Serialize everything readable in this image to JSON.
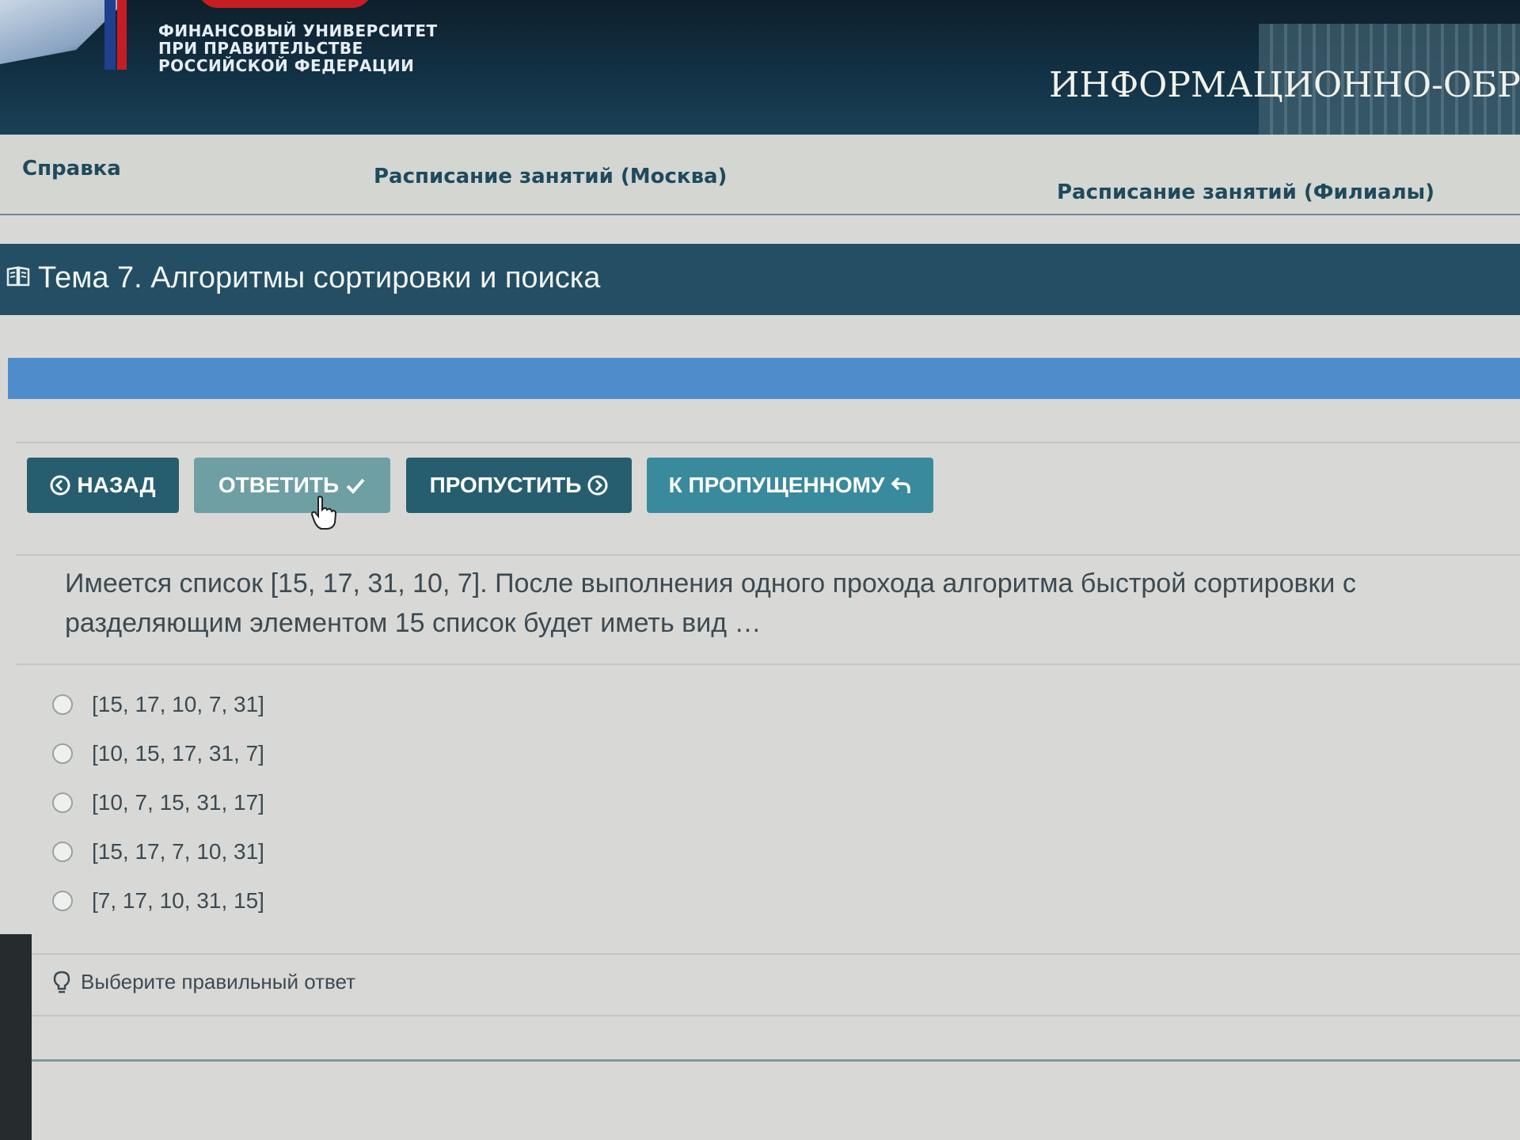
{
  "header": {
    "univ_line1": "ФИНАНСОВЫЙ УНИВЕРСИТЕТ",
    "univ_line2": "ПРИ ПРАВИТЕЛЬСТВЕ",
    "univ_line3": "РОССИЙСКОЙ ФЕДЕРАЦИИ",
    "portal_title": "ИНФОРМАЦИОННО-ОБРА"
  },
  "nav": {
    "help": "Справка",
    "schedule_moscow": "Расписание занятий (Москва)",
    "schedule_branches": "Расписание занятий (Филиалы)"
  },
  "topic": {
    "title": "Тема 7. Алгоритмы сортировки и поиска",
    "icon": "book-icon"
  },
  "progress": {
    "fraction": 1.0
  },
  "buttons": {
    "back": "НАЗАД",
    "answer": "ОТВЕТИТЬ",
    "skip": "ПРОПУСТИТЬ",
    "to_skipped": "К ПРОПУЩЕННОМУ"
  },
  "question": {
    "line1": "Имеется список [15, 17, 31, 10, 7]. После выполнения одного прохода алгоритма быстрой сортировки с",
    "line2": "разделяющим элементом 15 список будет иметь вид …"
  },
  "answers": [
    "[15, 17, 10, 7, 31]",
    "[10, 15, 17, 31, 7]",
    "[10, 7, 15, 31, 17]",
    "[15, 17, 7, 10, 31]",
    "[7, 17, 10, 31, 15]"
  ],
  "hint": "Выберите правильный ответ",
  "colors": {
    "header": "#123145",
    "topic_bar": "#234e63",
    "progress": "#4f8ccc",
    "btn_dark": "#275e6f",
    "btn_light": "#6e9fa3",
    "btn_teal": "#3a8a9d"
  }
}
